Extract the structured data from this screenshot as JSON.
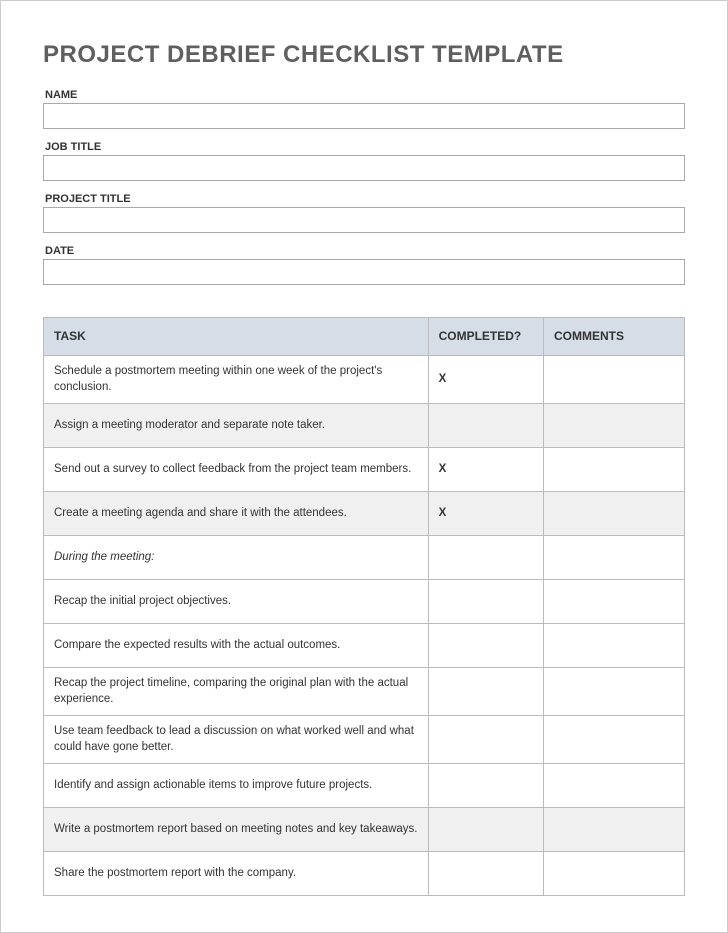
{
  "title": "PROJECT DEBRIEF CHECKLIST TEMPLATE",
  "fields": {
    "name": {
      "label": "NAME",
      "value": ""
    },
    "job_title": {
      "label": "JOB TITLE",
      "value": ""
    },
    "project_title": {
      "label": "PROJECT TITLE",
      "value": ""
    },
    "date": {
      "label": "DATE",
      "value": ""
    }
  },
  "table": {
    "headers": {
      "task": "TASK",
      "completed": "COMPLETED?",
      "comments": "COMMENTS"
    },
    "rows": [
      {
        "task": "Schedule a postmortem meeting within one week of the project's conclusion.",
        "completed": "X",
        "comments": "",
        "alt": false
      },
      {
        "task": "Assign a meeting moderator and separate note taker.",
        "completed": "",
        "comments": "",
        "alt": true
      },
      {
        "task": "Send out a survey to collect feedback from the project team members.",
        "completed": "X",
        "comments": "",
        "alt": false
      },
      {
        "task": "Create a meeting agenda and share it with the attendees.",
        "completed": "X",
        "comments": "",
        "alt": true
      },
      {
        "section": true,
        "task": "During the meeting:",
        "completed": "",
        "comments": ""
      },
      {
        "task": "Recap the initial project objectives.",
        "completed": "",
        "comments": "",
        "alt": false
      },
      {
        "task": "Compare the expected results with the actual outcomes.",
        "completed": "",
        "comments": "",
        "alt": false
      },
      {
        "task": "Recap the project timeline, comparing the original plan with the actual experience.",
        "completed": "",
        "comments": "",
        "alt": false
      },
      {
        "task": "Use team feedback to lead a discussion on what worked well and what could have gone better.",
        "completed": "",
        "comments": "",
        "alt": false
      },
      {
        "task": "Identify and assign actionable items to improve future projects.",
        "completed": "",
        "comments": "",
        "alt": false
      },
      {
        "task": "Write a postmortem report based on meeting notes and key takeaways.",
        "completed": "",
        "comments": "",
        "alt": true
      },
      {
        "task": "Share the postmortem report with the company.",
        "completed": "",
        "comments": "",
        "alt": false
      }
    ]
  }
}
